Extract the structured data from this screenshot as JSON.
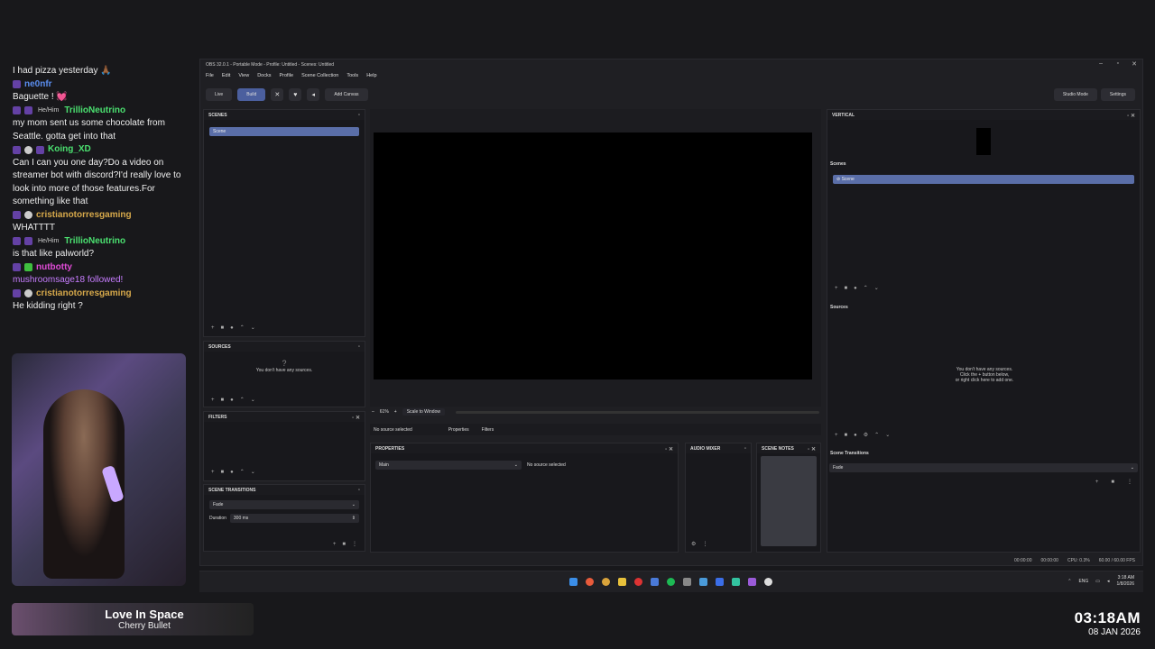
{
  "chat": {
    "messages": [
      {
        "type": "text",
        "text": "I had pizza yesterday 🙏🏾"
      },
      {
        "type": "user",
        "name": "ne0nfr",
        "color": "#5a8dee",
        "pronoun": "",
        "badges": [
          "pr"
        ]
      },
      {
        "type": "text",
        "text": "Baguette ! 💓"
      },
      {
        "type": "user",
        "name": "TrillioNeutrino",
        "color": "#4be070",
        "pronoun": "He/Him",
        "badges": [
          "pr",
          "pr"
        ]
      },
      {
        "type": "text",
        "text": "my mom sent us some chocolate from Seattle. gotta get into that"
      },
      {
        "type": "user",
        "name": "Koing_XD",
        "color": "#4be070",
        "pronoun": "",
        "badges": [
          "pr",
          "wh",
          "pr"
        ]
      },
      {
        "type": "text",
        "text": "Can I can you one day?Do a video on streamer bot with discord?I'd really love to look into more of those features.For something like that"
      },
      {
        "type": "user",
        "name": "cristianotorresgaming",
        "color": "#d7a94b",
        "pronoun": "",
        "badges": [
          "pr",
          "wh"
        ]
      },
      {
        "type": "text",
        "text": "WHATTTT"
      },
      {
        "type": "user",
        "name": "TrillioNeutrino",
        "color": "#4be070",
        "pronoun": "He/Him",
        "badges": [
          "pr",
          "pr"
        ]
      },
      {
        "type": "text",
        "text": "is that like palworld?"
      },
      {
        "type": "user",
        "name": "nutbotty",
        "color": "#e04bd6",
        "pronoun": "",
        "badges": [
          "pr",
          "gr"
        ]
      },
      {
        "type": "sys",
        "text": "mushroomsage18 followed!"
      },
      {
        "type": "user",
        "name": "cristianotorresgaming",
        "color": "#d7a94b",
        "pronoun": "",
        "badges": [
          "pr",
          "wh"
        ]
      },
      {
        "type": "text",
        "text": "He kidding right ?"
      }
    ]
  },
  "music": {
    "title": "Love In Space",
    "artist": "Cherry Bullet"
  },
  "clock": {
    "time": "03:18AM",
    "date": "08 JAN 2026"
  },
  "obs": {
    "title": "OBS 32.0.1 - Portable Mode - Profile: Untitled - Scenes: Untitled",
    "window_controls": [
      "–",
      "▫",
      "✕"
    ],
    "menu": [
      "File",
      "Edit",
      "View",
      "Docks",
      "Profile",
      "Scene Collection",
      "Tools",
      "Help"
    ],
    "toolbar": {
      "live": "Live",
      "build": "Build",
      "add_canvas": "Add Canvas",
      "studio_mode": "Studio Mode",
      "settings": "Settings"
    },
    "scenes": {
      "title": "SCENES",
      "items": [
        "Scene"
      ]
    },
    "sources": {
      "title": "SOURCES",
      "empty": "You don't have any sources."
    },
    "filters": {
      "title": "FILTERS"
    },
    "transitions": {
      "title": "SCENE TRANSITIONS",
      "value": "Fade",
      "duration_label": "Duration",
      "duration": "300 ms"
    },
    "preview": {
      "zoom": "61%",
      "scale": "Scale to Window",
      "no_source": "No source selected",
      "properties_tab": "Properties",
      "filters_tab": "Filters"
    },
    "properties": {
      "title": "PROPERTIES",
      "select": "Main",
      "note": "No source selected"
    },
    "audio": {
      "title": "AUDIO MIXER"
    },
    "notes": {
      "title": "SCENE NOTES"
    },
    "vertical": {
      "title": "VERTICAL",
      "scenes_label": "Scenes",
      "scene_item": "Scene",
      "sources_label": "Sources",
      "empty1": "You don't have any sources.",
      "empty2": "Click the + button below,",
      "empty3": "or right click here to add one.",
      "transitions_label": "Scene Transitions",
      "transition": "Fade"
    },
    "status": {
      "time1": "00:00:00",
      "time2": "00:00:00",
      "cpu": "CPU: 0.3%",
      "fps": "60.00 / 60.00 FPS"
    }
  },
  "taskbar": {
    "time": "3:18 AM",
    "date": "1/8/2026",
    "lang": "ENG"
  }
}
